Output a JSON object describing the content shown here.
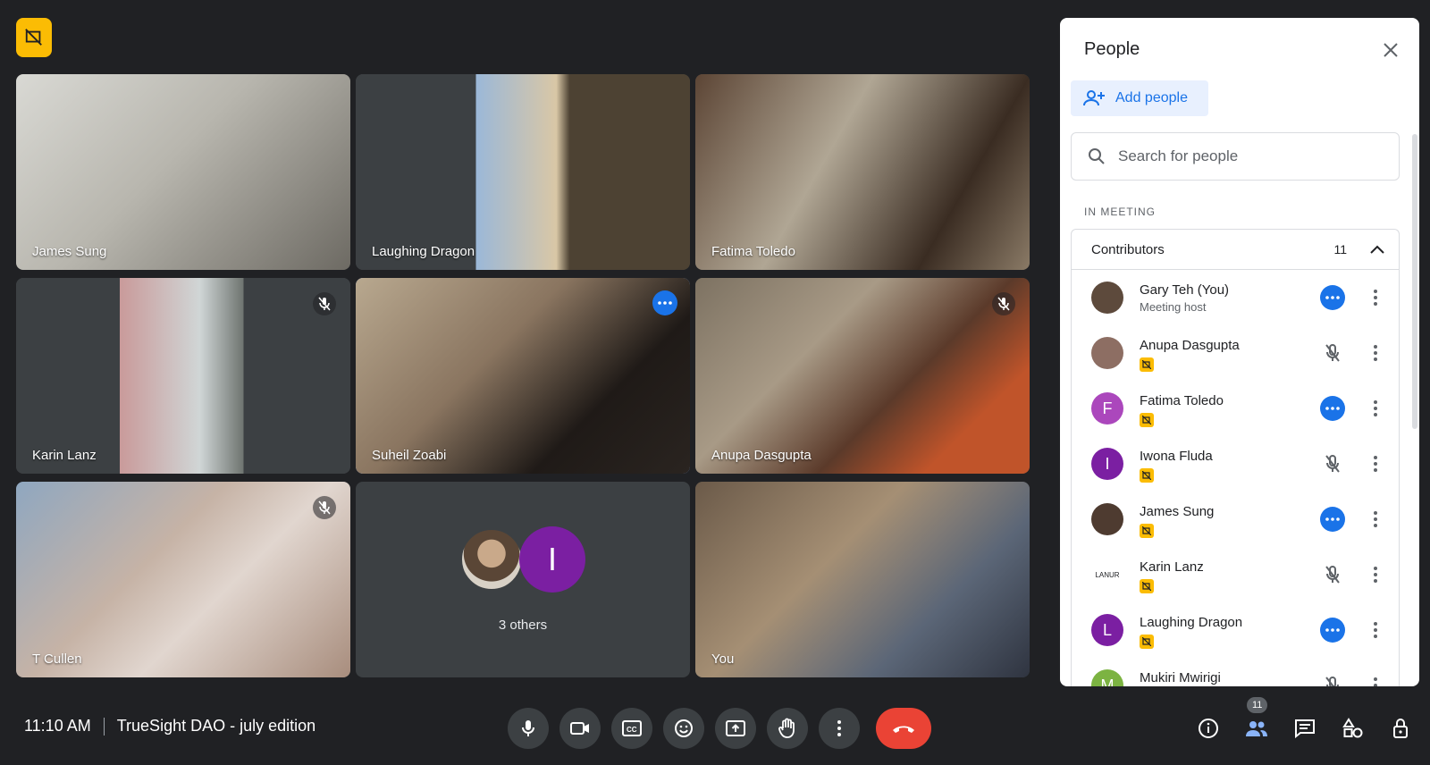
{
  "meeting": {
    "time": "11:10 AM",
    "title": "TrueSight DAO - july edition"
  },
  "tiles": [
    {
      "name": "James Sung",
      "muted": false,
      "bg": "linear-gradient(135deg,#d9d9d4,#b8b6ae 45%,#6d6a63)"
    },
    {
      "name": "Laughing Dragon",
      "muted": false,
      "bg": "linear-gradient(90deg,#3c4043 0 36%,#9bb8d8 36%,#d9c7a6 60%,#4d4233 64% 100%)"
    },
    {
      "name": "Fatima Toledo",
      "muted": false,
      "bg": "linear-gradient(120deg,#5c4535,#b0a694 40%,#3a2c22 75%,#8a7a66)"
    },
    {
      "name": "Karin Lanz",
      "muted": true,
      "bg": "linear-gradient(90deg,#3c4043 0 31%,#c99a9a 31%,#d0d6d6 55%,#6e7470 68%,#3c4043 68%)"
    },
    {
      "name": "Suheil Zoabi",
      "muted": false,
      "bg": "linear-gradient(135deg,#b8a88f,#8a7560 40%,#1f1a17 70%,#2a2420)",
      "active": true
    },
    {
      "name": "Anupa Dasgupta",
      "muted": true,
      "bg": "linear-gradient(135deg,#7d7262,#a89a86 35%,#5b3a2a 60%,#c0542a 80%)"
    },
    {
      "name": "T Cullen",
      "muted": true,
      "bg": "linear-gradient(135deg,#8fa7c0,#c6b3a6 40%,#e1d6cf 60%,#a88d7d)"
    },
    {
      "name": "",
      "muted": false,
      "others": "3 others"
    },
    {
      "name": "You",
      "muted": false,
      "bg": "linear-gradient(135deg,#6b5a49,#a58f74 40%,#5b6677 70%,#2f3440)"
    }
  ],
  "panel": {
    "title": "People",
    "add_label": "Add people",
    "search_placeholder": "Search for people",
    "section": "IN MEETING",
    "group_title": "Contributors",
    "group_count": "11",
    "people": [
      {
        "name": "Gary Teh (You)",
        "sub": "Meeting host",
        "initial": "",
        "color": "#5d4a3c",
        "state": "more"
      },
      {
        "name": "Anupa Dasgupta",
        "sub": "",
        "initial": "",
        "color": "#8d6e63",
        "state": "muted"
      },
      {
        "name": "Fatima Toledo",
        "sub": "",
        "initial": "F",
        "color": "#ab47bc",
        "state": "more"
      },
      {
        "name": "Iwona Fluda",
        "sub": "",
        "initial": "I",
        "color": "#7b1fa2",
        "state": "muted"
      },
      {
        "name": "James Sung",
        "sub": "",
        "initial": "",
        "color": "#4e3b30",
        "state": "more"
      },
      {
        "name": "Karin Lanz",
        "sub": "",
        "initial": "LANUR",
        "color": "#ffffff",
        "state": "muted"
      },
      {
        "name": "Laughing Dragon",
        "sub": "",
        "initial": "L",
        "color": "#7b1fa2",
        "state": "more"
      },
      {
        "name": "Mukiri Mwirigi",
        "sub": "",
        "initial": "M",
        "color": "#7cb342",
        "state": "muted"
      }
    ]
  },
  "toolbar": {
    "people_badge": "11"
  }
}
